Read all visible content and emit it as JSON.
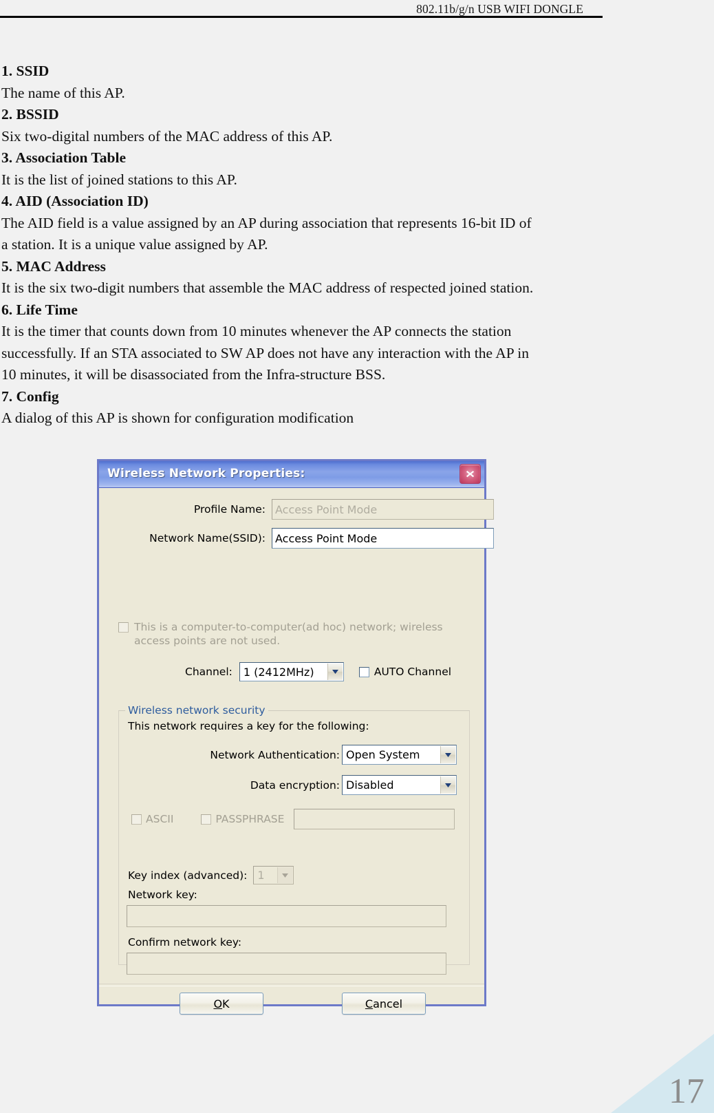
{
  "header": {
    "title": "802.11b/g/n USB WIFI DONGLE"
  },
  "body_lines": [
    {
      "text": "1. SSID",
      "heading": true
    },
    {
      "text": "The name of this AP.",
      "heading": false
    },
    {
      "text": "2. BSSID",
      "heading": true
    },
    {
      "text": "Six two-digital numbers of the MAC address of this AP.",
      "heading": false
    },
    {
      "text": "3. Association Table",
      "heading": true
    },
    {
      "text": "It is the list of joined stations to this AP.",
      "heading": false
    },
    {
      "text": "4. AID (Association ID)",
      "heading": true
    },
    {
      "text": "The AID field is a value assigned by an AP during association that represents 16-bit ID of",
      "heading": false
    },
    {
      "text": "a station. It is a unique value assigned by AP.",
      "heading": false
    },
    {
      "text": "5. MAC Address",
      "heading": true
    },
    {
      "text": "It is the six two-digit numbers that assemble the MAC address of respected joined station.",
      "heading": false
    },
    {
      "text": "6. Life Time",
      "heading": true
    },
    {
      "text": "It is the timer that counts down from 10 minutes whenever the AP connects the station",
      "heading": false
    },
    {
      "text": "successfully. If an STA associated to SW AP does not have any interaction with the AP in",
      "heading": false
    },
    {
      "text": "10 minutes, it will be disassociated from the Infra-structure BSS.",
      "heading": false
    },
    {
      "text": "7. Config",
      "heading": true
    },
    {
      "text": "A dialog of this AP is shown for configuration modification",
      "heading": false
    }
  ],
  "dialog": {
    "title": "Wireless Network Properties:",
    "close_icon": "close-icon",
    "profile_name": {
      "label": "Profile Name:",
      "value": "Access Point Mode"
    },
    "network_name": {
      "label": "Network Name(SSID):",
      "value": "Access Point Mode"
    },
    "adhoc": {
      "label_line1": "This is a computer-to-computer(ad hoc) network; wireless",
      "label_line2": "access points are not used."
    },
    "channel": {
      "label": "Channel:",
      "value": "1  (2412MHz)",
      "auto_label": "AUTO Channel"
    },
    "security": {
      "legend": "Wireless network security",
      "note": "This network requires a key for the following:",
      "auth": {
        "label": "Network Authentication:",
        "value": "Open System"
      },
      "encryption": {
        "label": "Data encryption:",
        "value": "Disabled"
      },
      "ascii_label": "ASCII",
      "passphrase_label": "PASSPHRASE",
      "passphrase_value": "",
      "key_index": {
        "label": "Key index (advanced):",
        "value": "1"
      },
      "network_key": {
        "label": "Network key:",
        "value": ""
      },
      "confirm_key": {
        "label": "Confirm network key:",
        "value": ""
      }
    },
    "buttons": {
      "ok": "OK",
      "ok_mnemonic": "O",
      "ok_rest": "K",
      "cancel": "Cancel",
      "cancel_mnemonic": "C",
      "cancel_rest": "ancel"
    }
  },
  "footer": {
    "page_number": "17",
    "accent_color": "#d4e8f0"
  }
}
